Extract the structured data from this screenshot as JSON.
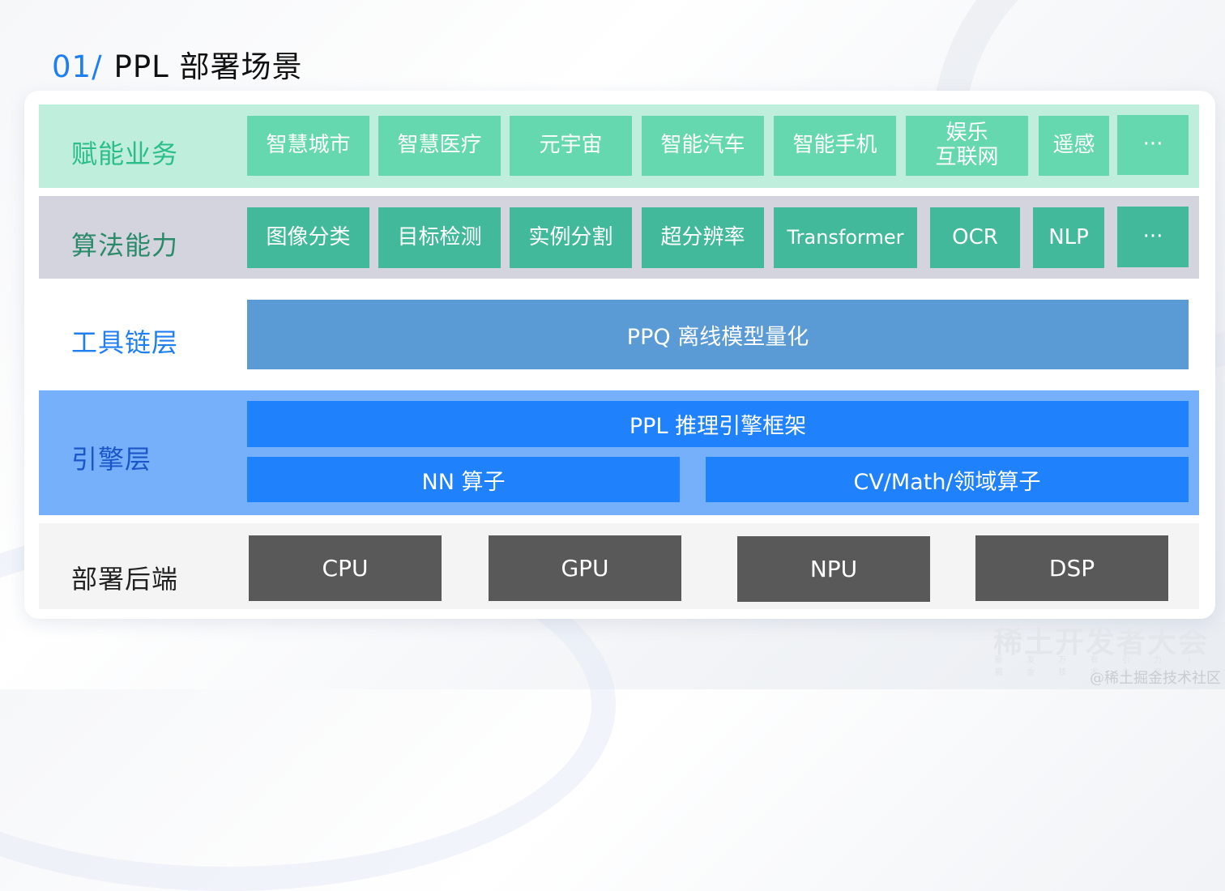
{
  "slide": {
    "number": "01/",
    "title": "PPL 部署场景"
  },
  "colors": {
    "accent": "#1f7ef0",
    "business_band": "#c0eedc",
    "business_chip": "#66d8b0",
    "algorithm_band": "#d3d4de",
    "algorithm_chip": "#43b99b",
    "toolchain_block": "#5b9bd5",
    "engine_band": "#76b0fb",
    "engine_block": "#2081fc",
    "backend_band": "#f4f4f4",
    "backend_block": "#595959"
  },
  "layers": {
    "business": {
      "label": "赋能业务",
      "items": [
        "智慧城市",
        "智慧医疗",
        "元宇宙",
        "智能汽车",
        "智能手机",
        "娱乐\n互联网",
        "遥感",
        "···"
      ]
    },
    "algorithm": {
      "label": "算法能力",
      "items": [
        "图像分类",
        "目标检测",
        "实例分割",
        "超分辨率",
        "Transformer",
        "OCR",
        "NLP",
        "···"
      ]
    },
    "toolchain": {
      "label": "工具链层",
      "block": "PPQ 离线模型量化"
    },
    "engine": {
      "label": "引擎层",
      "framework": "PPL 推理引擎框架",
      "nn_ops": "NN 算子",
      "domain_ops": "CV/Math/领域算子"
    },
    "backend": {
      "label": "部署后端",
      "items": [
        "CPU",
        "GPU",
        "NPU",
        "DSP"
      ]
    }
  },
  "watermark": {
    "event": "稀土开发者大会",
    "tagline": "新 发 万 有 引 力 丨 掘 金 技 术 未 来",
    "credit": "@稀土掘金技术社区"
  }
}
